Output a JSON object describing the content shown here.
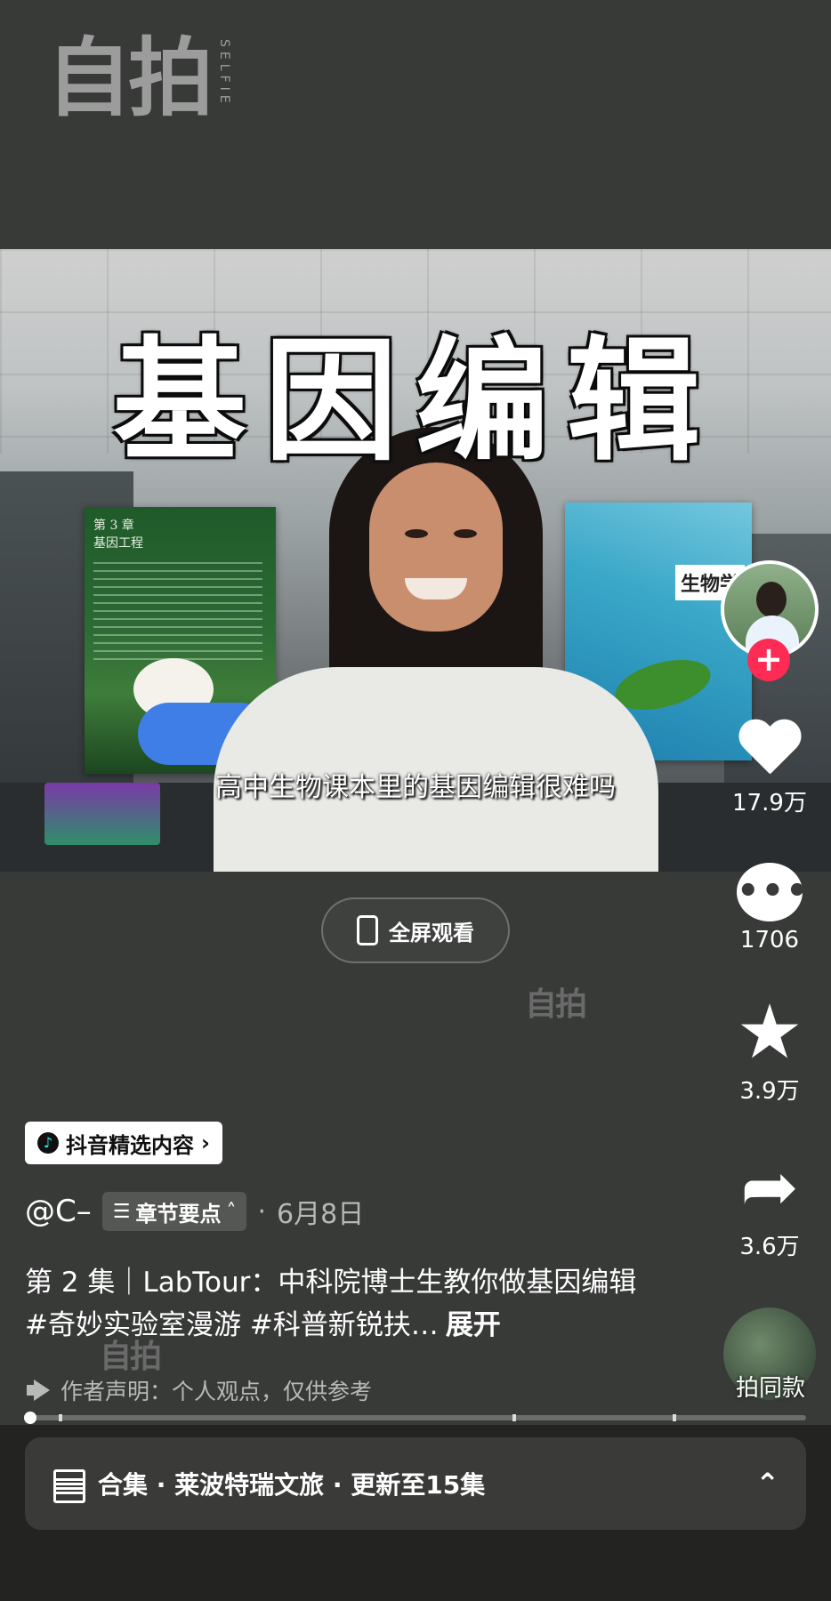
{
  "watermark": {
    "main": "自拍",
    "side": "SELFIE",
    "small": "自拍"
  },
  "video": {
    "title_overlay": "基因编辑",
    "book_left_chapter": "第 3 章",
    "book_left_title": "基因工程",
    "book_right_title": "生物学",
    "subtitle": "高中生物课本里的基因编辑很难吗"
  },
  "fullscreen": {
    "label": "全屏观看"
  },
  "actions": {
    "follow_symbol": "+",
    "likes": "17.9万",
    "comments": "1706",
    "favorites": "3.9万",
    "shares": "3.6万",
    "same_style_label": "拍同款"
  },
  "post": {
    "badge": "抖音精选内容",
    "author": "@C–",
    "chapter_chip": "章节要点",
    "date": "6月8日",
    "date_separator": "·",
    "description": "第 2 集｜LabTour：中科院博士生教你做基因编辑 #奇妙实验室漫游 #科普新锐扶…",
    "expand": "展开",
    "statement": "作者声明：个人观点，仅供参考"
  },
  "progress": {
    "played_fraction": 0.0
  },
  "collection": {
    "label": "合集 · 莱波特瑞文旅 · 更新至15集"
  },
  "colors": {
    "background": "#383a38",
    "accent_follow": "#fe2c55",
    "bottom_band": "#232422"
  },
  "icons": {
    "fullscreen": "phone-rotate-icon",
    "like": "heart-icon",
    "comment": "comment-icon",
    "favorite": "star-icon",
    "share": "share-icon",
    "collection": "layers-icon",
    "statement": "megaphone-icon"
  }
}
